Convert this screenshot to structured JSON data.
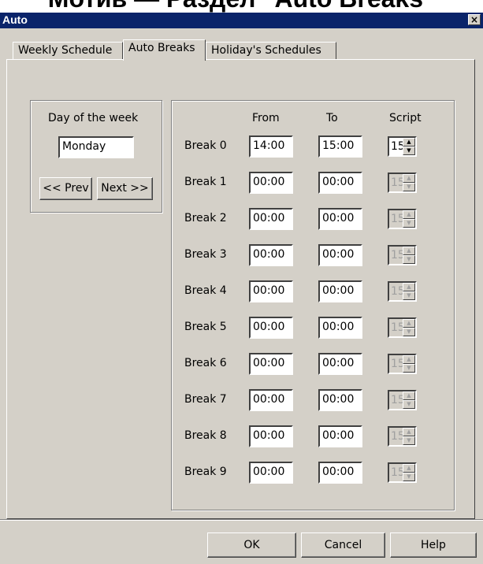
{
  "doc_heading": "Мотив — Раздел \"Auto Breaks\"",
  "window": {
    "title": "Auto",
    "close_glyph": "×"
  },
  "tabs": [
    {
      "label": "Weekly Schedule"
    },
    {
      "label": "Auto Breaks",
      "active": true
    },
    {
      "label": "Holiday's Schedules"
    }
  ],
  "day_panel": {
    "label": "Day of the week",
    "value": "Monday",
    "prev_label": "<< Prev",
    "next_label": "Next >>"
  },
  "breaks_panel": {
    "headers": {
      "from": "From",
      "to": "To",
      "script": "Script"
    },
    "rows": [
      {
        "label": "Break 0",
        "from": "14:00",
        "to": "15:00",
        "script": "15",
        "enabled": true
      },
      {
        "label": "Break 1",
        "from": "00:00",
        "to": "00:00",
        "script": "15",
        "enabled": false
      },
      {
        "label": "Break 2",
        "from": "00:00",
        "to": "00:00",
        "script": "15",
        "enabled": false
      },
      {
        "label": "Break 3",
        "from": "00:00",
        "to": "00:00",
        "script": "15",
        "enabled": false
      },
      {
        "label": "Break 4",
        "from": "00:00",
        "to": "00:00",
        "script": "15",
        "enabled": false
      },
      {
        "label": "Break 5",
        "from": "00:00",
        "to": "00:00",
        "script": "15",
        "enabled": false
      },
      {
        "label": "Break 6",
        "from": "00:00",
        "to": "00:00",
        "script": "15",
        "enabled": false
      },
      {
        "label": "Break 7",
        "from": "00:00",
        "to": "00:00",
        "script": "15",
        "enabled": false
      },
      {
        "label": "Break 8",
        "from": "00:00",
        "to": "00:00",
        "script": "15",
        "enabled": false
      },
      {
        "label": "Break 9",
        "from": "00:00",
        "to": "00:00",
        "script": "15",
        "enabled": false
      }
    ]
  },
  "footer": {
    "ok_label": "OK",
    "cancel_label": "Cancel",
    "help_label": "Help"
  },
  "icons": {
    "spin_up": "▲",
    "spin_down": "▼"
  },
  "colors": {
    "titlebar": "#0a246a",
    "face": "#d4d0c8"
  }
}
